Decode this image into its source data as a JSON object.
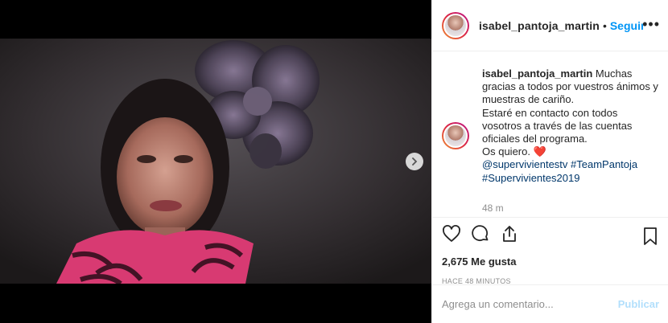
{
  "post": {
    "username": "isabel_pantoja_martin",
    "follow_label": "Seguir",
    "separator": "•",
    "more_label": "•••"
  },
  "caption": {
    "username": "isabel_pantoja_martin",
    "line1": "Muchas gracias a todos por vuestros ánimos y muestras de cariño.",
    "line2": "Estaré en contacto con todos vosotros a través de las cuentas oficiales del programa.",
    "line3": "Os quiero. ❤️",
    "tag1": "@supervivientestv",
    "tag2": "#TeamPantoja",
    "tag3": "#Supervivientes2019",
    "time_ago": "48 m"
  },
  "engagement": {
    "likes": "2,675 Me gusta",
    "timestamp": "HACE 48 MINUTOS"
  },
  "comment": {
    "placeholder": "Agrega un comentario...",
    "publish_label": "Publicar"
  },
  "icons": {
    "like": "heart-icon",
    "comment": "comment-icon",
    "share": "share-icon",
    "save": "bookmark-icon",
    "next": "chevron-right-icon"
  },
  "colors": {
    "link": "#00376b",
    "follow": "#0095f6",
    "publish_disabled": "#b2dffc",
    "muted": "#8e8e8e"
  }
}
